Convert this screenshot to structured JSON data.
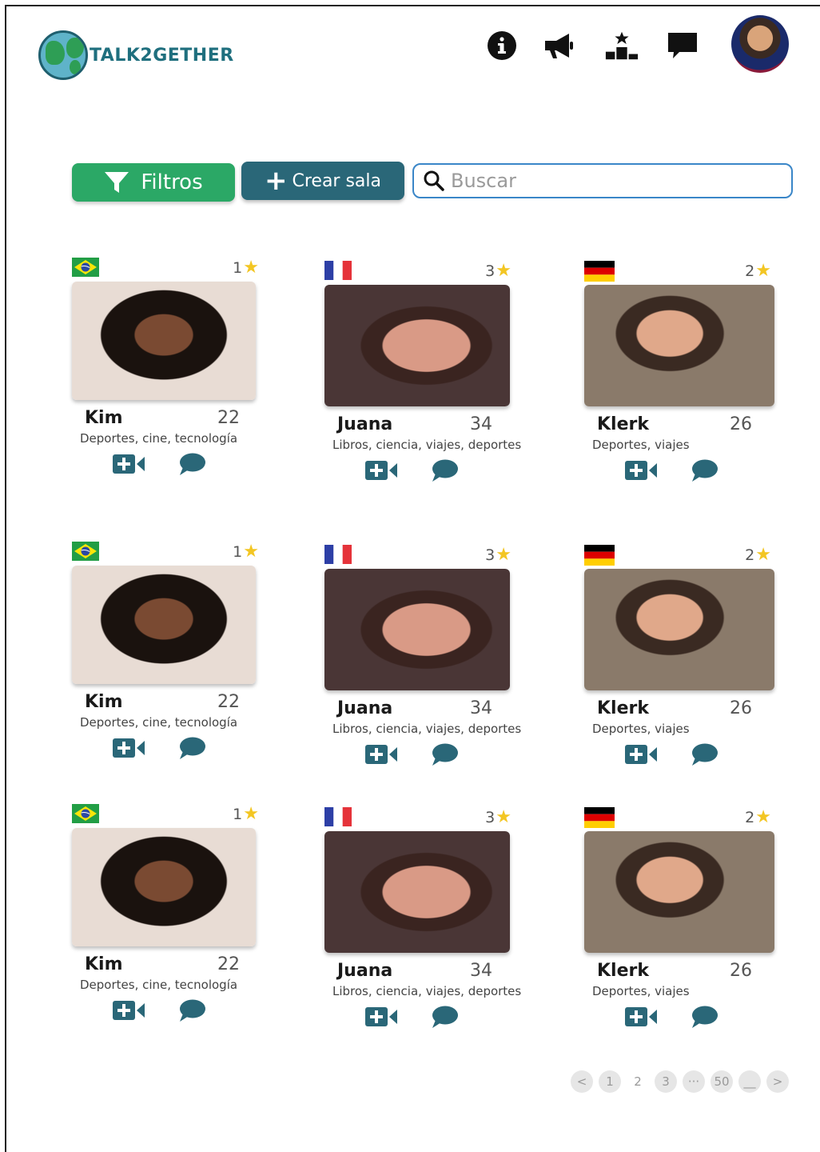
{
  "header": {
    "brand": "TALK2GETHER",
    "icons": [
      "info-icon",
      "megaphone-icon",
      "podium-icon",
      "chat-icon"
    ]
  },
  "toolbar": {
    "filter_label": "Filtros",
    "create_room_label": "Crear sala",
    "search_placeholder": "Buscar"
  },
  "colors": {
    "filter_green": "#2ba866",
    "teal": "#2a6778",
    "search_border": "#3a86c8",
    "star": "#f3c623"
  },
  "cards": [
    {
      "name": "Kim",
      "age": "22",
      "rating": "1",
      "flag": "brazil",
      "interests": "Deportes, cine, tecnología"
    },
    {
      "name": "Juana",
      "age": "34",
      "rating": "3",
      "flag": "france",
      "interests": "Libros, ciencia, viajes, deportes"
    },
    {
      "name": "Klerk",
      "age": "26",
      "rating": "2",
      "flag": "germany",
      "interests": "Deportes, viajes"
    },
    {
      "name": "Kim",
      "age": "22",
      "rating": "1",
      "flag": "brazil",
      "interests": "Deportes, cine, tecnología"
    },
    {
      "name": "Juana",
      "age": "34",
      "rating": "3",
      "flag": "france",
      "interests": "Libros, ciencia, viajes, deportes"
    },
    {
      "name": "Klerk",
      "age": "26",
      "rating": "2",
      "flag": "germany",
      "interests": "Deportes, viajes"
    },
    {
      "name": "Kim",
      "age": "22",
      "rating": "1",
      "flag": "brazil",
      "interests": "Deportes, cine, tecnología"
    },
    {
      "name": "Juana",
      "age": "34",
      "rating": "3",
      "flag": "france",
      "interests": "Libros, ciencia, viajes, deportes"
    },
    {
      "name": "Klerk",
      "age": "26",
      "rating": "2",
      "flag": "germany",
      "interests": "Deportes, viajes"
    }
  ],
  "pagination": {
    "prev": "<",
    "pages": [
      "1",
      "2",
      "3",
      "···",
      "50",
      "__"
    ],
    "current": "2",
    "next": ">"
  }
}
